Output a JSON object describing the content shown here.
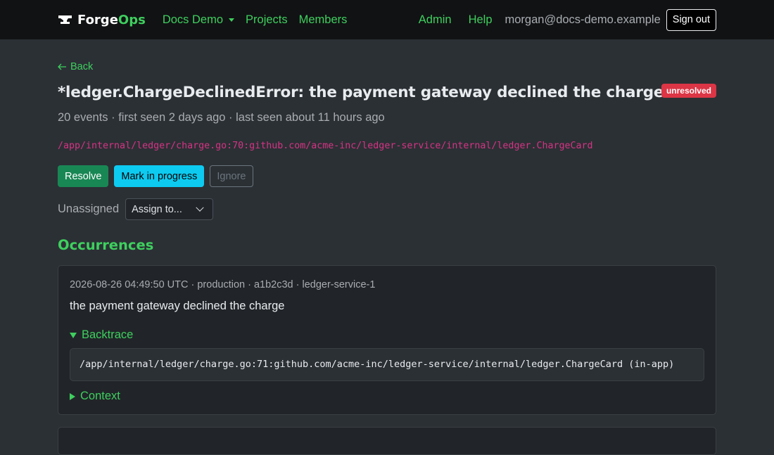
{
  "navbar": {
    "brand_part1": "Forge",
    "brand_part2": "Ops",
    "org_menu_label": "Docs Demo",
    "projects_label": "Projects",
    "members_label": "Members",
    "admin_label": "Admin",
    "help_label": "Help",
    "user_email": "morgan@docs-demo.example",
    "signout_label": "Sign out"
  },
  "issue": {
    "back_label": "Back",
    "title": "*ledger.ChargeDeclinedError: the payment gateway declined the charge",
    "status_badge": "unresolved",
    "meta": "20 events · first seen 2 days ago · last seen about 11 hours ago",
    "location": "/app/internal/ledger/charge.go:70:github.com/acme-inc/ledger-service/internal/ledger.ChargeCard",
    "resolve_label": "Resolve",
    "progress_label": "Mark in progress",
    "ignore_label": "Ignore",
    "assignee": "Unassigned",
    "assign_placeholder": "Assign to..."
  },
  "occurrences": {
    "heading": "Occurrences",
    "items": [
      {
        "meta": "2026-08-26 04:49:50 UTC · production · a1b2c3d · ledger-service-1",
        "message": "the payment gateway declined the charge",
        "backtrace_label": "Backtrace",
        "backtrace_line": "/app/internal/ledger/charge.go:71:github.com/acme-inc/ledger-service/internal/ledger.ChargeCard (in-app)",
        "context_label": "Context"
      }
    ]
  },
  "colors": {
    "accent": "#3ecf5e",
    "danger": "#dc3545",
    "success": "#198754",
    "info": "#0dcaf0",
    "mono_path": "#d63384"
  }
}
